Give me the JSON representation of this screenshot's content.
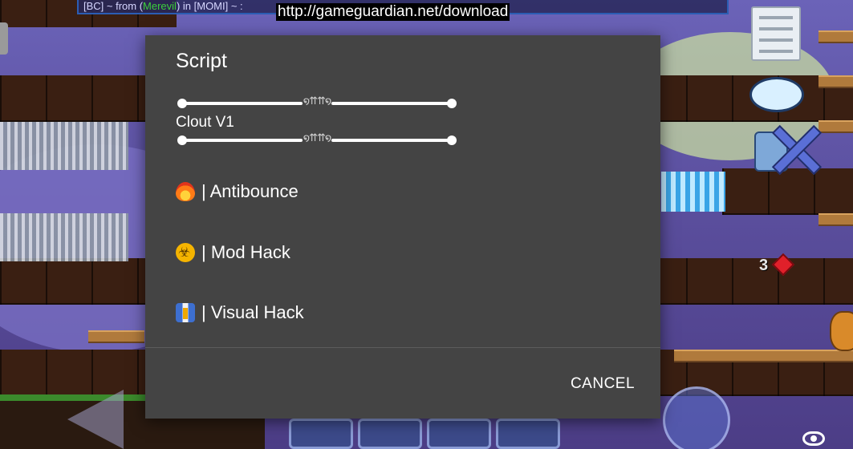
{
  "overlay": {
    "chat_prefix": "[BC] ~ from (",
    "chat_name": "Merevil",
    "chat_suffix": ") in [MOMI] ~ :",
    "url": "http://gameguardian.net/download",
    "gem_count": "3"
  },
  "dialog": {
    "title": "Script",
    "divider_ornament": "໑⇈⇈໑",
    "script_name": "Clout V1",
    "items": [
      {
        "icon": "fire-icon",
        "label": "| Antibounce"
      },
      {
        "icon": "biohazard-icon",
        "label": "| Mod Hack"
      },
      {
        "icon": "suit-icon",
        "label": "| Visual Hack"
      }
    ],
    "cancel_label": "CANCEL"
  },
  "colors": {
    "dialog_bg": "#444444",
    "text": "#ffffff"
  }
}
